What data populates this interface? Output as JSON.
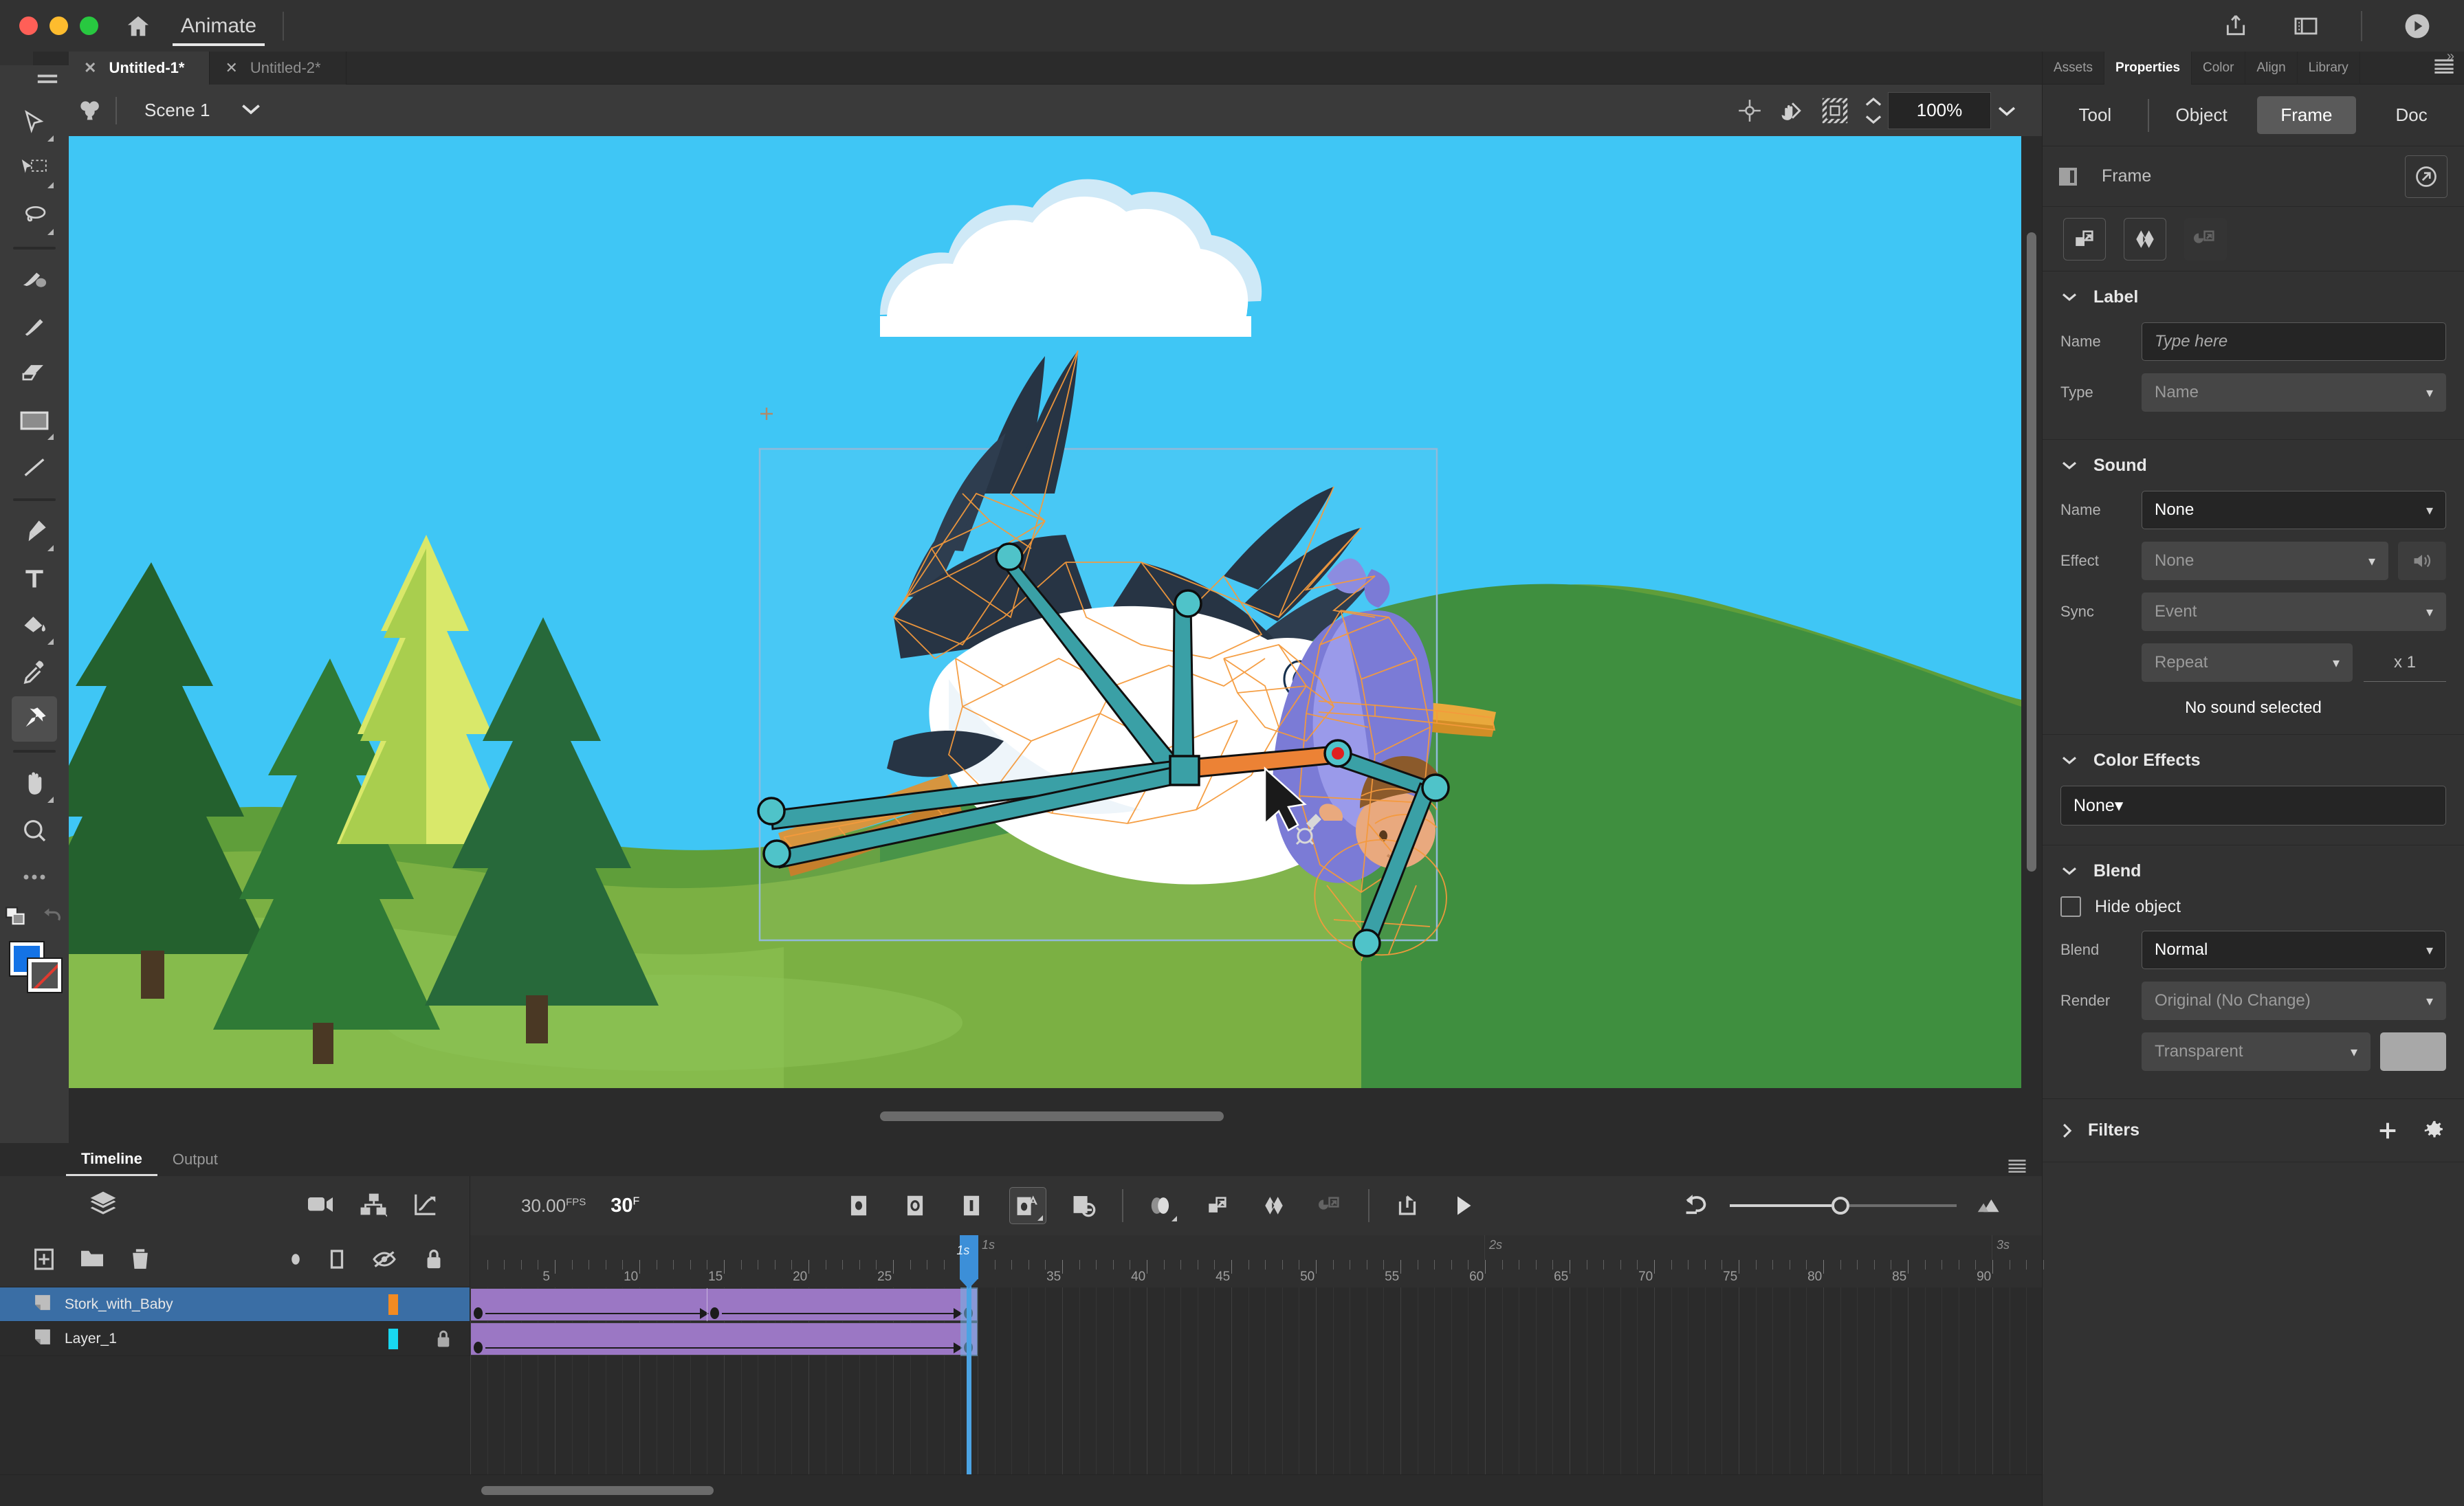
{
  "titlebar": {
    "app_name": "Animate",
    "home_icon": "home-icon",
    "share_icon": "share-icon",
    "panel_icon": "workspace-icon",
    "play_icon": "play-circle-icon"
  },
  "doc_tabs": [
    {
      "label": "Untitled-1*",
      "active": true
    },
    {
      "label": "Untitled-2*",
      "active": false
    }
  ],
  "tools": [
    {
      "name": "selection-tool",
      "icon": "arrow-cursor-icon",
      "has_flyout": true,
      "selected": false
    },
    {
      "name": "free-transform-tool",
      "icon": "free-transform-icon",
      "has_flyout": true,
      "selected": false
    },
    {
      "name": "lasso-tool",
      "icon": "lasso-icon",
      "has_flyout": true,
      "selected": false
    },
    {
      "name": "paint-brush-tool",
      "icon": "paint-brush-icon",
      "has_flyout": false,
      "selected": false
    },
    {
      "name": "brush-tool",
      "icon": "brush-icon",
      "has_flyout": false,
      "selected": false
    },
    {
      "name": "eraser-tool",
      "icon": "eraser-icon",
      "has_flyout": false,
      "selected": false
    },
    {
      "name": "rectangle-tool",
      "icon": "rectangle-icon",
      "has_flyout": true,
      "selected": false
    },
    {
      "name": "line-tool",
      "icon": "line-icon",
      "has_flyout": false,
      "selected": false
    },
    {
      "name": "pen-tool",
      "icon": "pen-icon",
      "has_flyout": true,
      "selected": false
    },
    {
      "name": "text-tool",
      "icon": "text-t-icon",
      "has_flyout": false,
      "selected": false
    },
    {
      "name": "paint-bucket-tool",
      "icon": "paint-bucket-icon",
      "has_flyout": true,
      "selected": false
    },
    {
      "name": "eyedropper-tool",
      "icon": "eyedropper-icon",
      "has_flyout": false,
      "selected": false
    },
    {
      "name": "asset-warp-tool",
      "icon": "pin-icon",
      "has_flyout": false,
      "selected": true
    },
    {
      "name": "hand-tool",
      "icon": "hand-icon",
      "has_flyout": true,
      "selected": false
    },
    {
      "name": "zoom-tool",
      "icon": "magnifier-icon",
      "has_flyout": false,
      "selected": false
    },
    {
      "name": "more-tools",
      "icon": "ellipsis-icon",
      "has_flyout": false,
      "selected": false
    }
  ],
  "swatches": {
    "fill_color": "#1473e6",
    "stroke_color": "#525252"
  },
  "canvas_toolbar": {
    "scene_name": "Scene 1",
    "club_icon": "edit-scene-icon",
    "center_icon": "center-stage-icon",
    "rotate_icon": "rotate-stage-icon",
    "clip_icon": "clip-content-icon",
    "zoom_value": "100%"
  },
  "properties": {
    "panel_tabs": [
      {
        "label": "Assets",
        "active": false
      },
      {
        "label": "Properties",
        "active": true
      },
      {
        "label": "Color",
        "active": false
      },
      {
        "label": "Align",
        "active": false
      },
      {
        "label": "Library",
        "active": false
      }
    ],
    "sub_tabs": [
      {
        "label": "Tool",
        "active": false
      },
      {
        "label": "Object",
        "active": false
      },
      {
        "label": "Frame",
        "active": true
      },
      {
        "label": "Doc",
        "active": false
      }
    ],
    "header": {
      "title": "Frame",
      "expand_icon": "open-in-new-icon"
    },
    "quick_icons": [
      {
        "name": "create-classic-tween-icon",
        "disabled": false
      },
      {
        "name": "create-shape-tween-icon",
        "disabled": false
      },
      {
        "name": "create-motion-tween-icon",
        "disabled": true
      }
    ],
    "label_section": {
      "title": "Label",
      "name_label": "Name",
      "name_placeholder": "Type here",
      "type_label": "Type",
      "type_value": "Name"
    },
    "sound_section": {
      "title": "Sound",
      "name_label": "Name",
      "name_value": "None",
      "effect_label": "Effect",
      "effect_value": "None",
      "effect_edit_icon": "sound-edit-icon",
      "sync_label": "Sync",
      "sync_value": "Event",
      "repeat_value": "Repeat",
      "repeat_count": "x 1",
      "status": "No sound selected"
    },
    "color_effects_section": {
      "title": "Color Effects",
      "value": "None"
    },
    "blend_section": {
      "title": "Blend",
      "hide_object_label": "Hide object",
      "hide_object_checked": false,
      "blend_label": "Blend",
      "blend_value": "Normal",
      "render_label": "Render",
      "render_value": "Original (No Change)",
      "transparent_value": "Transparent",
      "color_swatch": "#a8a8a8"
    },
    "filters_section": {
      "title": "Filters",
      "add_icon": "plus-icon",
      "options_icon": "gear-icon",
      "collapsed": true
    }
  },
  "timeline": {
    "tabs": [
      {
        "label": "Timeline",
        "active": true
      },
      {
        "label": "Output",
        "active": false
      }
    ],
    "layers_icon": "layer-stack-icon",
    "toolbar_left_icons": [
      "camera-icon",
      "layer-parenting-icon",
      "graph-editor-icon"
    ],
    "fps_value": "30.00",
    "fps_unit": "FPS",
    "frames_value": "30",
    "frames_unit": "F",
    "center_icons": [
      {
        "name": "insert-keyframe-icon",
        "selected": false
      },
      {
        "name": "insert-blank-keyframe-icon",
        "selected": false
      },
      {
        "name": "insert-frame-icon",
        "selected": false
      },
      {
        "name": "create-keyframe-auto-icon",
        "selected": true
      },
      {
        "name": "delete-frame-icon",
        "selected": false
      },
      {
        "name": "onion-skin-icon",
        "selected": false
      },
      {
        "name": "classic-tween-icon",
        "selected": false
      },
      {
        "name": "shape-tween-icon",
        "selected": false
      },
      {
        "name": "motion-tween-icon",
        "selected": false
      },
      {
        "name": "loop-playback-icon",
        "selected": false
      },
      {
        "name": "play-icon",
        "selected": false
      }
    ],
    "right_icons": [
      "reset-zoom-icon",
      "preview-size-icon"
    ],
    "layer_header_icons": [
      "new-layer-icon",
      "new-folder-icon",
      "delete-layer-icon"
    ],
    "layer_header_attrs": [
      "keyframe-dot-icon",
      "outline-icon",
      "eye-hidden-icon",
      "lock-icon"
    ],
    "layers": [
      {
        "name": "Stork_with_Baby",
        "color": "#f28b22",
        "selected": true,
        "locked": false,
        "span_start": 1,
        "span_end": 30,
        "keyframes": [
          1,
          15,
          30
        ]
      },
      {
        "name": "Layer_1",
        "color": "#18d7f0",
        "selected": false,
        "locked": true,
        "span_start": 1,
        "span_end": 30,
        "keyframes": [
          1,
          30
        ]
      }
    ],
    "playhead_frame": 30,
    "playhead_label": "1s",
    "ruler_labels": [
      5,
      10,
      15,
      20,
      25,
      30,
      35,
      40,
      45,
      50,
      55,
      60,
      65,
      70,
      75,
      80,
      85,
      90
    ],
    "second_markers": [
      {
        "label": "1s",
        "frame": 30
      },
      {
        "label": "2s",
        "frame": 60
      },
      {
        "label": "3s",
        "frame": 90
      }
    ]
  },
  "stage": {
    "artwork_name": "stork-with-baby-illustration",
    "sky_color": "#3fc6f5",
    "cloud_color": "#ffffff",
    "hill_colors": [
      "#7bb043",
      "#3f8f3f",
      "#2e7a33"
    ],
    "mesh_color": "#f59a3c",
    "bone_color": "#3aa0a6",
    "joint_color": "#4fc3c9",
    "root_joint_color": "#e02020",
    "selection_box_color": "#8fb8d8",
    "cursor": "asset-warp-cursor"
  }
}
